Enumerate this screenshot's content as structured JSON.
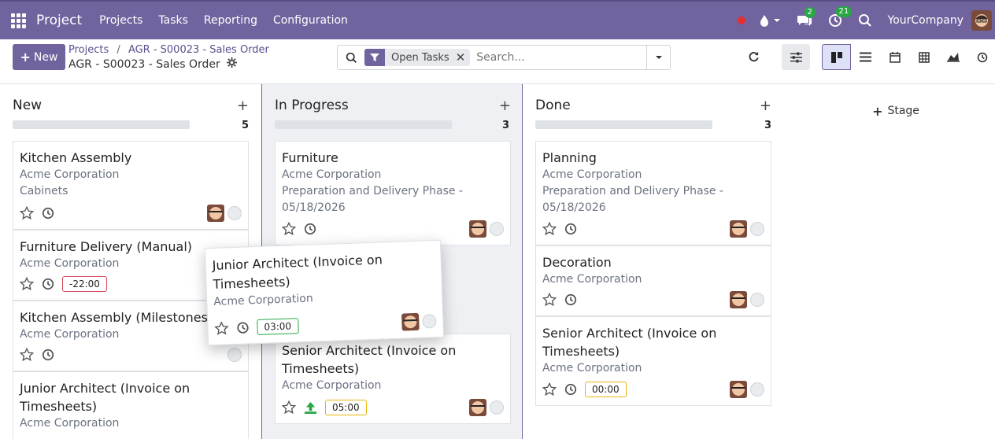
{
  "navbar": {
    "brand": "Project",
    "menu": [
      "Projects",
      "Tasks",
      "Reporting",
      "Configuration"
    ],
    "chat_count": "2",
    "activity_count": "21",
    "company": "YourCompany"
  },
  "control": {
    "new_label": "New",
    "breadcrumb_parent": "Projects",
    "breadcrumb_sep": "/",
    "breadcrumb_current": "AGR - S00023 - Sales Order",
    "page_title": "AGR - S00023 - Sales Order",
    "facet_label": "Open Tasks",
    "search_placeholder": "Search..."
  },
  "stage_add_label": "Stage",
  "columns": [
    {
      "title": "New",
      "count": "5",
      "cards": [
        {
          "title": "Kitchen Assembly",
          "lines": [
            "Acme Corporation",
            "Cabinets"
          ],
          "time": ""
        },
        {
          "title": "Furniture Delivery (Manual)",
          "lines": [
            "Acme Corporation"
          ],
          "time": "-22:00"
        },
        {
          "title": "Kitchen Assembly (Milestones)",
          "lines": [
            "Acme Corporation"
          ],
          "time": ""
        },
        {
          "title": "Junior Architect (Invoice on Timesheets)",
          "lines": [
            "Acme Corporation"
          ],
          "time": ""
        }
      ]
    },
    {
      "title": "In Progress",
      "count": "3",
      "cards": [
        {
          "title": "Furniture",
          "lines": [
            "Acme Corporation",
            "Preparation and Delivery Phase - 05/18/2026"
          ],
          "time": ""
        },
        {
          "title": "Senior Architect (Invoice on Timesheets)",
          "lines": [
            "Acme Corporation"
          ],
          "time": "05:00"
        }
      ]
    },
    {
      "title": "Done",
      "count": "3",
      "cards": [
        {
          "title": "Planning",
          "lines": [
            "Acme Corporation",
            "Preparation and Delivery Phase - 05/18/2026"
          ],
          "time": ""
        },
        {
          "title": "Decoration",
          "lines": [
            "Acme Corporation"
          ],
          "time": ""
        },
        {
          "title": "Senior Architect (Invoice on Timesheets)",
          "lines": [
            "Acme Corporation"
          ],
          "time": "00:00"
        }
      ]
    }
  ],
  "dragged_card": {
    "title": "Junior Architect (Invoice on Timesheets)",
    "line": "Acme Corporation",
    "time": "03:00"
  },
  "colors": {
    "brand": "#71639e",
    "danger": "#d44c59",
    "success": "#28a745",
    "warning": "#e9b50b"
  }
}
